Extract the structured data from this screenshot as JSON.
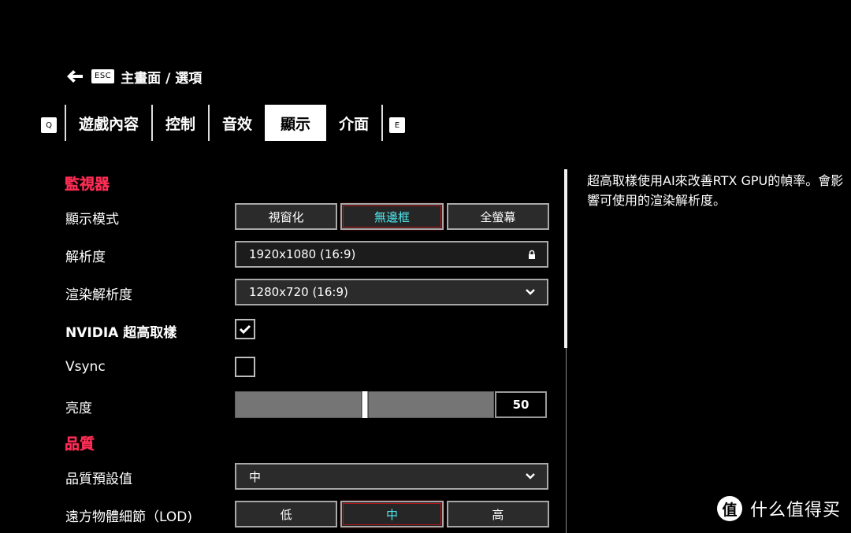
{
  "breadcrumb": {
    "back_icon": "arrow-left-icon",
    "esc_key": "ESC",
    "path": "主畫面 / 選項"
  },
  "tabs": {
    "prev_key": "Q",
    "next_key": "E",
    "items": [
      {
        "label": "遊戲內容",
        "active": false
      },
      {
        "label": "控制",
        "active": false
      },
      {
        "label": "音效",
        "active": false
      },
      {
        "label": "顯示",
        "active": true
      },
      {
        "label": "介面",
        "active": false
      }
    ]
  },
  "sections": {
    "monitor": {
      "title": "監視器",
      "display_mode": {
        "label": "顯示模式",
        "options": [
          "視窗化",
          "無邊框",
          "全螢幕"
        ],
        "selected": "無邊框"
      },
      "resolution": {
        "label": "解析度",
        "value": "1920x1080 (16:9)",
        "icon": "lock-icon"
      },
      "render_resolution": {
        "label": "渲染解析度",
        "value": "1280x720 (16:9)",
        "icon": "chevron-down-icon"
      },
      "nvidia_upscaling": {
        "label": "NVIDIA 超高取樣",
        "checked": true
      },
      "vsync": {
        "label": "Vsync",
        "checked": false
      },
      "brightness": {
        "label": "亮度",
        "value": "50",
        "percent": 50
      }
    },
    "quality": {
      "title": "品質",
      "preset": {
        "label": "品質預設值",
        "value": "中",
        "icon": "chevron-down-icon"
      },
      "lod": {
        "label": "遠方物體細節（LOD)",
        "options": [
          "低",
          "中",
          "高"
        ],
        "selected": "中"
      }
    }
  },
  "description": "超高取樣使用AI來改善RTX GPU的幀率。會影響可使用的渲染解析度。",
  "watermark": {
    "logo": "值",
    "text": "什么值得买"
  },
  "colors": {
    "section_title": "#ff2d55",
    "selected_option_text": "#4fe8ee",
    "selected_option_outline": "#b0151c",
    "background": "#000000"
  }
}
